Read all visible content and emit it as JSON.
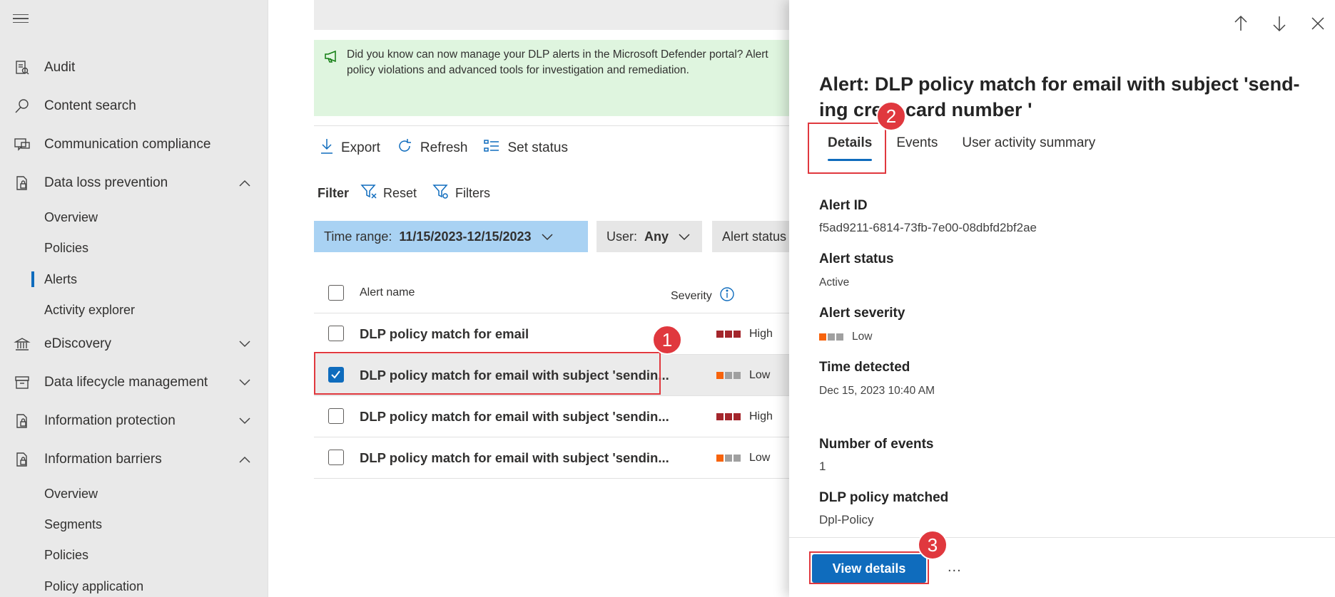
{
  "sidebar": {
    "items": [
      {
        "label": "Audit",
        "icon": "audit-icon"
      },
      {
        "label": "Content search",
        "icon": "search-icon"
      },
      {
        "label": "Communication compliance",
        "icon": "chat-icon"
      },
      {
        "label": "Data loss prevention",
        "icon": "lock-doc-icon",
        "expanded": true
      },
      {
        "label": "eDiscovery",
        "icon": "bank-icon",
        "expanded": false
      },
      {
        "label": "Data lifecycle management",
        "icon": "archive-icon",
        "expanded": false
      },
      {
        "label": "Information protection",
        "icon": "lock-doc-icon",
        "expanded": false
      },
      {
        "label": "Information barriers",
        "icon": "lock-doc-icon",
        "expanded": true
      }
    ],
    "dlp_sub": [
      "Overview",
      "Policies",
      "Alerts",
      "Activity explorer"
    ],
    "dlp_active": "Alerts",
    "ib_sub": [
      "Overview",
      "Segments",
      "Policies",
      "Policy application"
    ]
  },
  "banner": {
    "line1": "Did you know can now manage your DLP alerts in the Microsoft Defender portal? Alert",
    "line2": "policy violations and advanced tools for investigation and remediation."
  },
  "toolbar": {
    "export": "Export",
    "refresh": "Refresh",
    "set_status": "Set status"
  },
  "filter": {
    "label": "Filter",
    "reset": "Reset",
    "filters": "Filters"
  },
  "pills": {
    "time_label": "Time range:",
    "time_value": "11/15/2023-12/15/2023",
    "user_label": "User:",
    "user_value": "Any",
    "status_label": "Alert status"
  },
  "table": {
    "col_name": "Alert name",
    "col_severity": "Severity",
    "rows": [
      {
        "name": "DLP policy match for email",
        "severity": "High",
        "checked": false
      },
      {
        "name": "DLP policy match for email with subject 'sendin...",
        "severity": "Low",
        "checked": true
      },
      {
        "name": "DLP policy match for email with subject 'sendin...",
        "severity": "High",
        "checked": false
      },
      {
        "name": "DLP policy match for email with subject 'sendin...",
        "severity": "Low",
        "checked": false
      }
    ]
  },
  "panel": {
    "title_line1": "Alert: DLP policy match for email with subject 'send-",
    "title_line2": "ing cre",
    "title_line2_end": "t card number '",
    "tabs": [
      "Details",
      "Events",
      "User activity summary"
    ],
    "fields": {
      "alert_id_label": "Alert ID",
      "alert_id": "f5ad9211-6814-73fb-7e00-08dbfd2bf2ae",
      "status_label": "Alert status",
      "status": "Active",
      "severity_label": "Alert severity",
      "severity": "Low",
      "time_label": "Time detected",
      "time": "Dec 15, 2023 10:40 AM",
      "events_label": "Number of events",
      "events": "1",
      "policy_label": "DLP policy matched",
      "policy": "Dpl-Policy"
    },
    "view_details": "View details",
    "more": "..."
  },
  "badges": [
    "1",
    "2",
    "3"
  ],
  "colors": {
    "accent": "#0f6cbd",
    "high": "#a4262c",
    "low": "#f7630c",
    "annotation": "#e0383e"
  }
}
